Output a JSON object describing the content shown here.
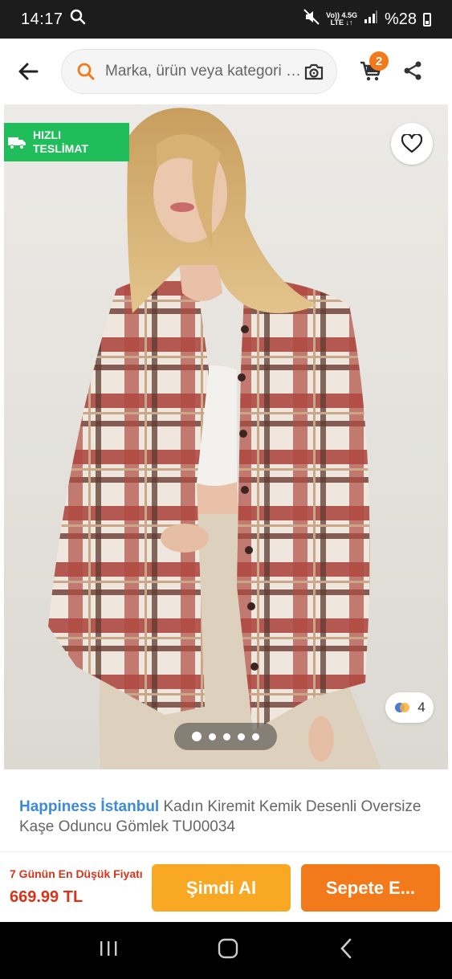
{
  "status_bar": {
    "time": "14:17",
    "network_top": "Vo)) 4.5G",
    "network_bottom": "LTE ↓↑",
    "battery": "%28"
  },
  "search": {
    "placeholder": "Marka, ürün veya kategori ara"
  },
  "cart": {
    "count": "2"
  },
  "gallery": {
    "fast_delivery_line1": "HIZLI",
    "fast_delivery_line2": "TESLİMAT",
    "image_count": "4",
    "total_images": 5,
    "active_index": 0
  },
  "product": {
    "brand": "Happiness İstanbul",
    "name": " Kadın Kiremit Kemik Desenli Oversize Kaşe Oduncu Gömlek TU00034"
  },
  "purchase": {
    "price_note": "7 Günün En Düşük Fiyatı",
    "price": "669.99 TL",
    "buy_now_label": "Şimdi Al",
    "add_to_cart_label": "Sepete E..."
  },
  "colors": {
    "accent_orange": "#f27a1a",
    "buy_yellow": "#f9a824",
    "fast_green": "#1fbe5b",
    "price_red": "#d8341a",
    "brand_blue": "#3d8ad6"
  }
}
